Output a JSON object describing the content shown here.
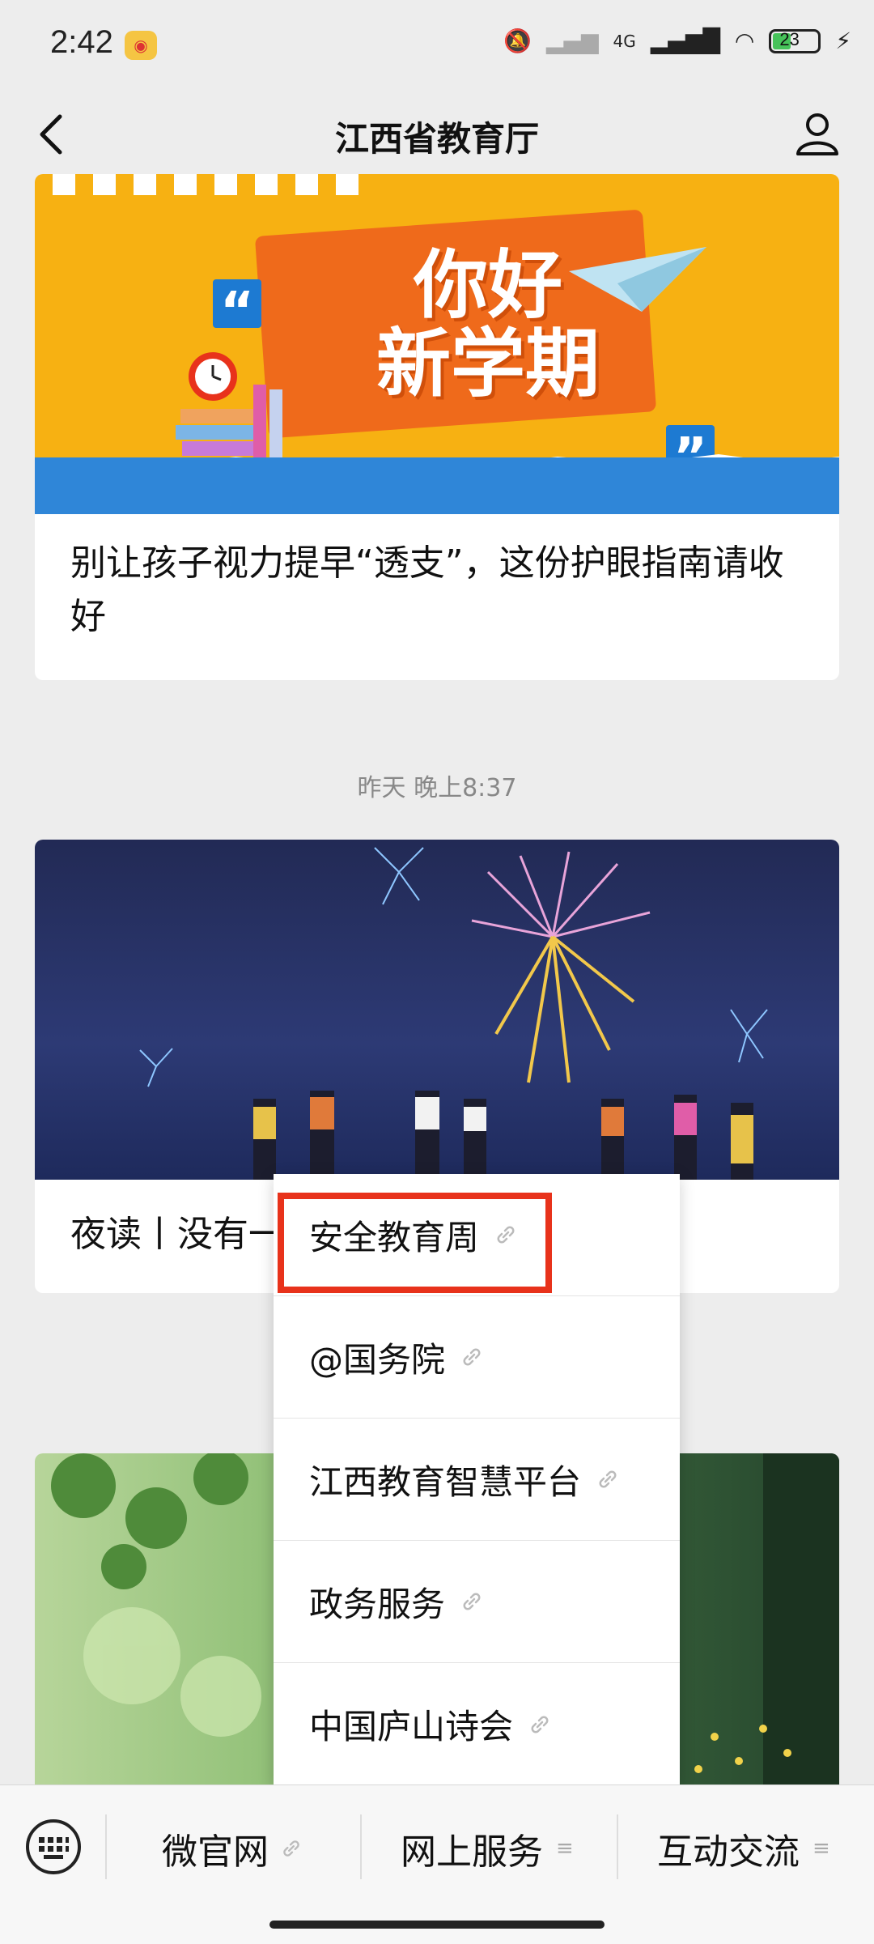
{
  "status_bar": {
    "time": "2:42",
    "network": "4G",
    "battery": "23"
  },
  "nav": {
    "title": "江西省教育厅"
  },
  "articles": [
    {
      "banner_text_line1": "你好",
      "banner_text_line2": "新学期",
      "title": "别让孩子视力提早“透支”，这份护眼指南请收好"
    },
    {
      "title": "夜读丨没有一"
    }
  ],
  "timestamp": "昨天 晚上8:37",
  "menu": {
    "items": [
      "安全教育周",
      "@国务院",
      "江西教育智慧平台",
      "政务服务",
      "中国庐山诗会"
    ],
    "highlighted_index": 0
  },
  "bottom_tabs": [
    {
      "label": "微官网",
      "type": "link"
    },
    {
      "label": "网上服务",
      "type": "menu"
    },
    {
      "label": "互动交流",
      "type": "menu"
    }
  ],
  "colors": {
    "highlight": "#e8321b",
    "banner1": "#f7b112",
    "accent_blue": "#1d7ad2"
  }
}
